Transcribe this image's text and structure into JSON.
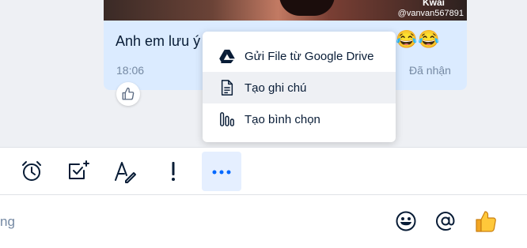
{
  "message": {
    "watermark_handle": "@vanvan567891",
    "watermark_top": "Kwai",
    "text": "Anh em lưu ý",
    "emojis": "😂😂",
    "time": "18:06",
    "status": "Đã nhận"
  },
  "menu": {
    "items": [
      {
        "label": "Gửi File từ Google Drive",
        "icon": "google-drive-icon"
      },
      {
        "label": "Tạo ghi chú",
        "icon": "note-icon"
      },
      {
        "label": "Tạo bình chọn",
        "icon": "poll-icon"
      }
    ]
  },
  "toolbar": {
    "buttons": [
      "alarm-clock-icon",
      "task-check-icon",
      "text-format-icon",
      "exclamation-icon",
      "more-icon"
    ],
    "active": "more-icon"
  },
  "input": {
    "placeholder": "ng"
  },
  "colors": {
    "accent": "#0068ff",
    "bubble": "#dbebff",
    "muted": "#7589a3"
  }
}
